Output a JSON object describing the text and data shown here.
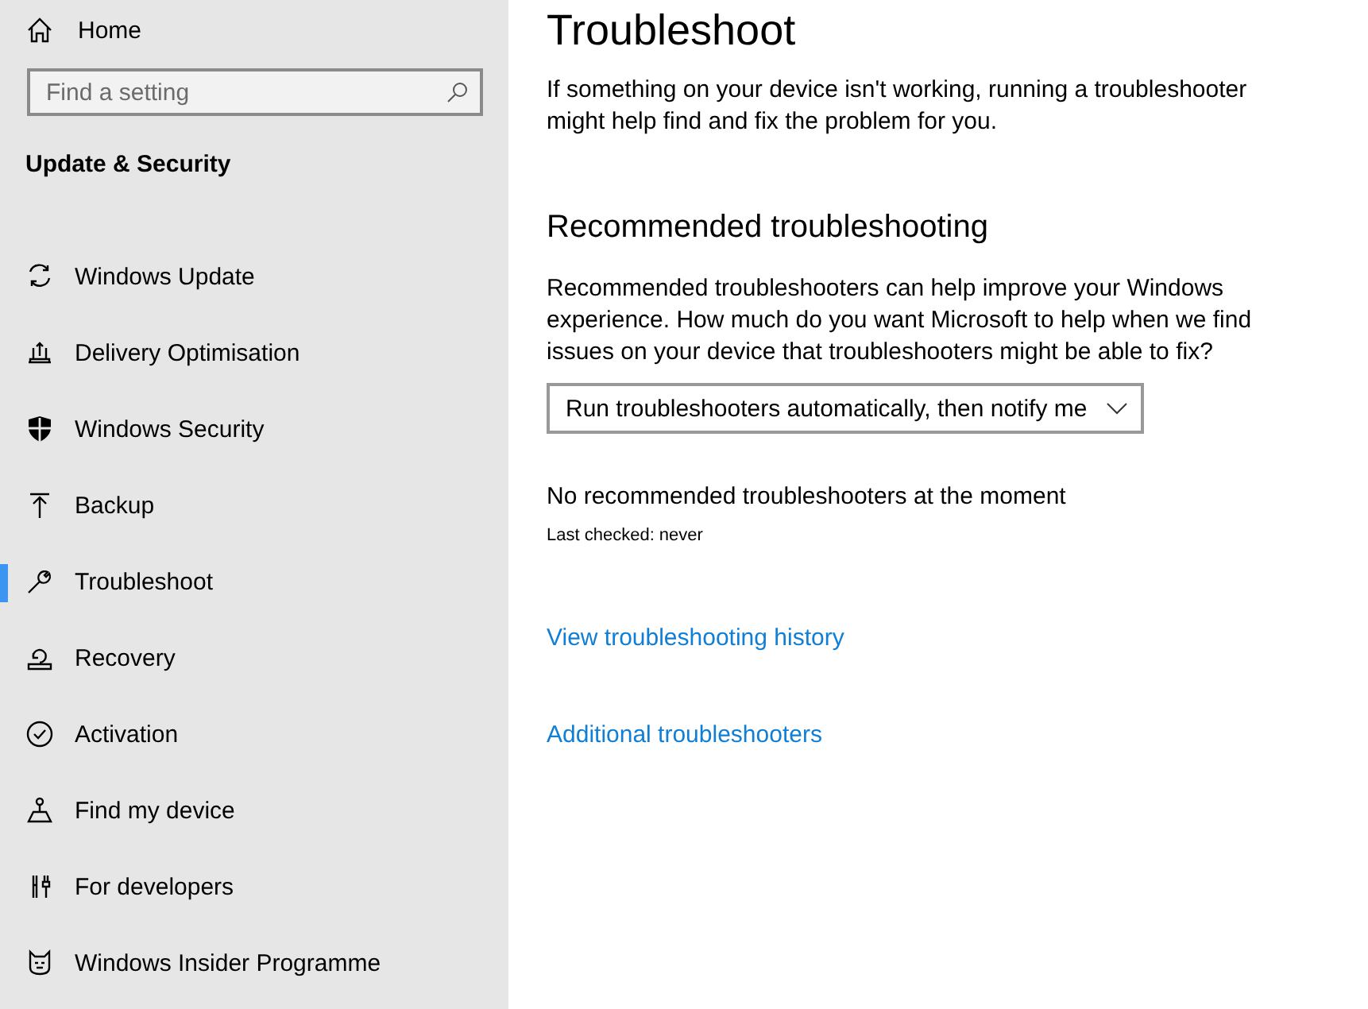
{
  "sidebar": {
    "home": "Home",
    "search": {
      "placeholder": "Find a setting"
    },
    "section_title": "Update & Security",
    "items": [
      {
        "label": "Windows Update",
        "selected": false
      },
      {
        "label": "Delivery Optimisation",
        "selected": false
      },
      {
        "label": "Windows Security",
        "selected": false
      },
      {
        "label": "Backup",
        "selected": false
      },
      {
        "label": "Troubleshoot",
        "selected": true
      },
      {
        "label": "Recovery",
        "selected": false
      },
      {
        "label": "Activation",
        "selected": false
      },
      {
        "label": "Find my device",
        "selected": false
      },
      {
        "label": "For developers",
        "selected": false
      },
      {
        "label": "Windows Insider Programme",
        "selected": false
      }
    ]
  },
  "main": {
    "title": "Troubleshoot",
    "intro": "If something on your device isn't working, running a troubleshooter might help find and fix the problem for you.",
    "section_title": "Recommended troubleshooting",
    "section_text": "Recommended troubleshooters can help improve your Windows experience. How much do you want Microsoft to help when we find issues on your device that troubleshooters might be able to fix?",
    "dropdown": {
      "value": "Run troubleshooters automatically, then notify me"
    },
    "status": "No recommended troubleshooters at the moment",
    "last_checked": "Last checked: never",
    "links": [
      "View troubleshooting history",
      "Additional troubleshooters"
    ]
  }
}
